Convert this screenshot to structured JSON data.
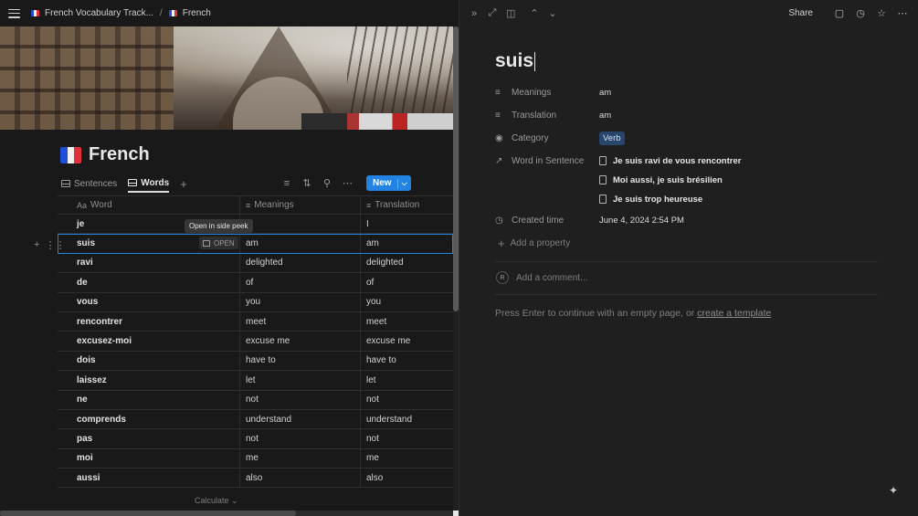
{
  "breadcrumb": {
    "workspace": "French Vocabulary Track...",
    "separator": "/",
    "page": "French"
  },
  "database": {
    "title": "French",
    "views": [
      {
        "label": "Sentences"
      },
      {
        "label": "Words"
      }
    ],
    "add_view": "+",
    "new_button": "New",
    "columns": {
      "word": "Word",
      "word_prefix": "Aa",
      "meanings": "Meanings",
      "translation": "Translation"
    },
    "rows": [
      {
        "word": "je",
        "meanings": "",
        "translation": "I"
      },
      {
        "word": "suis",
        "meanings": "am",
        "translation": "am"
      },
      {
        "word": "ravi",
        "meanings": "delighted",
        "translation": "delighted"
      },
      {
        "word": "de",
        "meanings": "of",
        "translation": "of"
      },
      {
        "word": "vous",
        "meanings": "you",
        "translation": "you"
      },
      {
        "word": "rencontrer",
        "meanings": "meet",
        "translation": "meet"
      },
      {
        "word": "excusez-moi",
        "meanings": "excuse me",
        "translation": "excuse me"
      },
      {
        "word": "dois",
        "meanings": "have to",
        "translation": "have to"
      },
      {
        "word": "laissez",
        "meanings": "let",
        "translation": "let"
      },
      {
        "word": "ne",
        "meanings": "not",
        "translation": "not"
      },
      {
        "word": "comprends",
        "meanings": "understand",
        "translation": "understand"
      },
      {
        "word": "pas",
        "meanings": "not",
        "translation": "not"
      },
      {
        "word": "moi",
        "meanings": "me",
        "translation": "me"
      },
      {
        "word": "aussi",
        "meanings": "also",
        "translation": "also"
      }
    ],
    "open_button": "OPEN",
    "tooltip": "Open in side peek",
    "calculate": "Calculate"
  },
  "peek": {
    "share": "Share",
    "title": "suis",
    "properties": {
      "meanings_label": "Meanings",
      "meanings_value": "am",
      "translation_label": "Translation",
      "translation_value": "am",
      "category_label": "Category",
      "category_value": "Verb",
      "sentence_label": "Word in Sentence",
      "sentences": [
        "Je suis ravi de vous rencontrer",
        "Moi aussi, je suis brésilien",
        "Je suis trop heureuse"
      ],
      "created_label": "Created time",
      "created_value": "June 4, 2024 2:54 PM"
    },
    "add_property": "Add a property",
    "avatar_initial": "R",
    "comment_placeholder": "Add a comment...",
    "hint_text": "Press Enter to continue with an empty page, or ",
    "hint_link": "create a template"
  },
  "colors": {
    "accent": "#2383e2",
    "tag_bg": "#28456c",
    "background": "#191919",
    "peek_background": "#1f1f1f"
  }
}
